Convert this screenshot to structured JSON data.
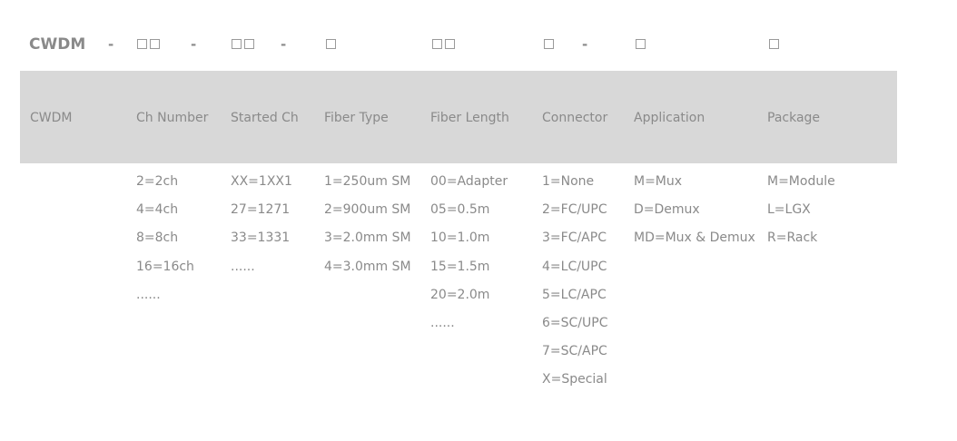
{
  "code_row": {
    "brand": "CWDM",
    "dash": "-"
  },
  "headers": {
    "cwdm": "CWDM",
    "ch_number": "Ch Number",
    "started_ch": "Started Ch",
    "fiber_type": "Fiber Type",
    "fiber_length": "Fiber Length",
    "connector": "Connector",
    "application": "Application",
    "package": "Package"
  },
  "columns": {
    "ch_number": [
      "2=2ch",
      "4=4ch",
      "8=8ch",
      "16=16ch",
      "......"
    ],
    "started_ch": [
      "XX=1XX1",
      "27=1271",
      "33=1331",
      "......"
    ],
    "fiber_type": [
      "1=250um SM",
      "2=900um SM",
      "3=2.0mm SM",
      "4=3.0mm SM"
    ],
    "fiber_length": [
      "00=Adapter",
      "05=0.5m",
      "10=1.0m",
      "15=1.5m",
      "20=2.0m",
      "......"
    ],
    "connector": [
      "1=None",
      "2=FC/UPC",
      "3=FC/APC",
      "4=LC/UPC",
      "5=LC/APC",
      "6=SC/UPC",
      "7=SC/APC",
      "X=Special"
    ],
    "application": [
      "M=Mux",
      "D=Demux",
      "MD=Mux & Demux"
    ],
    "package": [
      "M=Module",
      "L=LGX",
      "R=Rack"
    ]
  }
}
